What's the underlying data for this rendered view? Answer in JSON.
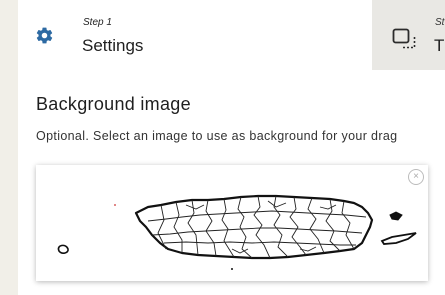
{
  "steps": [
    {
      "number": "Step 1",
      "title": "Settings",
      "icon": "gear-icon",
      "active": true
    },
    {
      "number": "St",
      "title": "T",
      "icon": "drag-drop-icon",
      "active": false
    }
  ],
  "section": {
    "title": "Background image",
    "description": "Optional. Select an image to use as background for your drag"
  },
  "image": {
    "subject": "map of Puerto Rico with municipal borders",
    "remove_label": "×"
  },
  "colors": {
    "page_background": "#f1efe8",
    "active_step": "#ffffff",
    "inactive_step": "#e9e8e4",
    "accent": "#2d6aa3"
  }
}
